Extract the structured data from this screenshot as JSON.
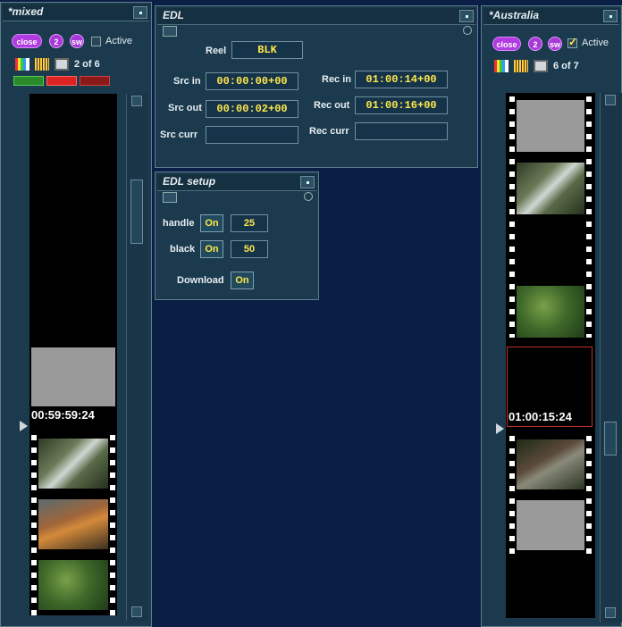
{
  "left_panel": {
    "title": "*mixed",
    "close_label": "close",
    "badge_2": "2",
    "badge_sw": "sw",
    "active_label": "Active",
    "active_checked": false,
    "counter": "2 of 6",
    "timecode": "00:59:59:24"
  },
  "right_panel": {
    "title": "*Australia",
    "close_label": "close",
    "badge_2": "2",
    "badge_sw": "sw",
    "active_label": "Active",
    "active_checked": true,
    "counter": "6 of 7",
    "timecode": "01:00:15:24"
  },
  "edl_panel": {
    "title": "EDL",
    "reel_label": "Reel",
    "reel_value": "BLK",
    "src_in_label": "Src in",
    "src_in_value": "00:00:00+00",
    "src_out_label": "Src out",
    "src_out_value": "00:00:02+00",
    "src_curr_label": "Src curr",
    "src_curr_value": "",
    "rec_in_label": "Rec in",
    "rec_in_value": "01:00:14+00",
    "rec_out_label": "Rec out",
    "rec_out_value": "01:00:16+00",
    "rec_curr_label": "Rec curr",
    "rec_curr_value": ""
  },
  "edl_setup_panel": {
    "title": "EDL setup",
    "handle_label": "handle",
    "handle_toggle": "On",
    "handle_value": "25",
    "black_label": "black",
    "black_toggle": "On",
    "black_value": "50",
    "download_label": "Download",
    "download_toggle": "On"
  },
  "colors": {
    "background": "#0b1e45",
    "panel": "#1c3a4e",
    "field_text": "#ffe84a",
    "accent_purple": "#b03be0",
    "selected_frame_border": "#c0302a"
  }
}
